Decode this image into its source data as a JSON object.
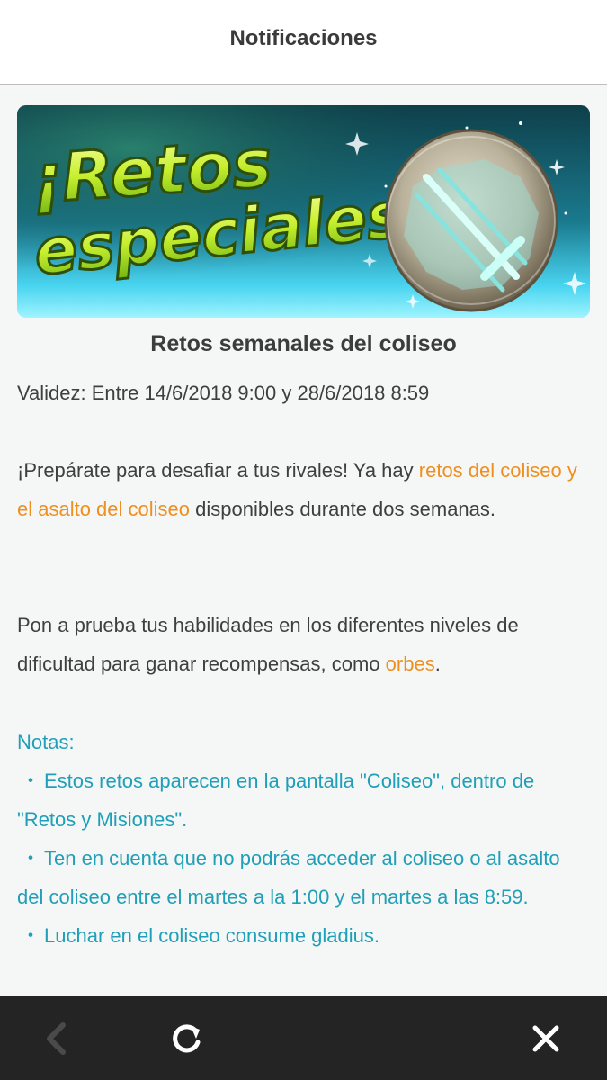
{
  "header": {
    "title": "Notificaciones"
  },
  "banner": {
    "line1": "¡Retos",
    "line2": "especiales!",
    "emblem": "sword-orb-emblem"
  },
  "article": {
    "title": "Retos semanales del coliseo",
    "validity": "Validez: Entre 14/6/2018 9:00 y 28/6/2018 8:59",
    "para1": {
      "before": "¡Prepárate para desafiar a tus rivales! Ya hay ",
      "highlight": "retos del coliseo y el asalto del coliseo",
      "after": " disponibles durante dos semanas."
    },
    "para2": {
      "before": "Pon a prueba tus habilidades en los diferentes niveles de dificultad para ganar recompensas, como ",
      "highlight": "orbes",
      "after": "."
    },
    "notes": {
      "heading": "Notas:",
      "bullet": "・",
      "items": [
        "Estos retos aparecen en la pantalla \"Coliseo\", dentro de \"Retos y Misiones\".",
        "Ten en cuenta que no podrás acceder al coliseo o al asalto del coliseo entre el martes a la 1:00 y el martes a las 8:59.",
        "Luchar en el coliseo consume gladius."
      ]
    }
  },
  "colors": {
    "highlight": "#ef8f1f",
    "notes": "#1f9fb8",
    "bottom_bar": "#242424"
  },
  "bottom_bar": {
    "back_icon": "chevron-left-icon",
    "reload_icon": "reload-icon",
    "close_icon": "close-icon"
  }
}
